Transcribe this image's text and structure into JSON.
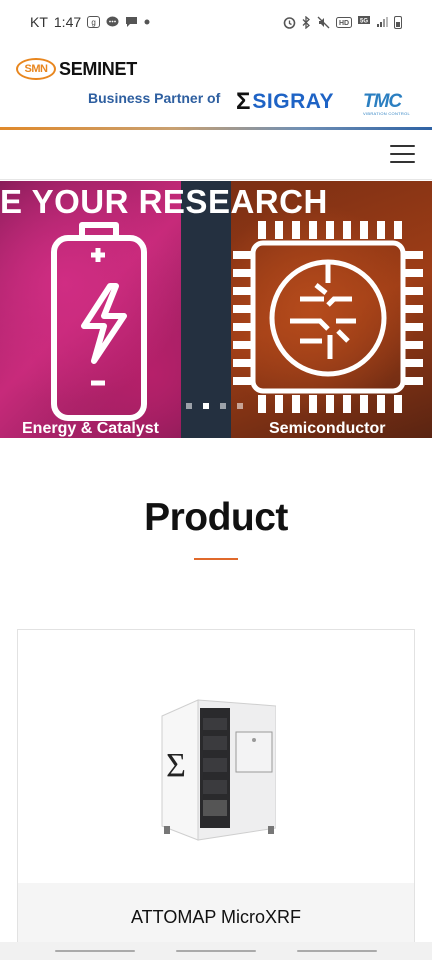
{
  "status_bar": {
    "carrier": "KT",
    "time": "1:47",
    "left_icons": [
      "g-icon",
      "chat-bubble-icon",
      "message-icon",
      "dot-icon"
    ],
    "right_icons": [
      "alarm-icon",
      "bluetooth-icon",
      "mute-icon",
      "hd-icon",
      "5g-icon",
      "signal-icon",
      "battery-icon"
    ]
  },
  "header": {
    "logo_badge": "SMN",
    "logo_text": "SEMINET",
    "partner_label": "Business Partner of",
    "partner_1": "SIGRAY",
    "partner_1_mark": "Σ",
    "partner_2": "TMC",
    "partner_2_sub": "VIBRATION CONTROL"
  },
  "nav": {
    "menu_icon": "hamburger-menu-icon"
  },
  "banner": {
    "headline": "E YOUR RESEARCH",
    "slides": [
      {
        "caption": "Energy & Catalyst",
        "icon": "battery-lightning-icon"
      },
      {
        "caption": "Semiconductor",
        "icon": "circuit-chip-icon"
      }
    ],
    "dots_count": 4,
    "active_dot": 2
  },
  "products": {
    "section_title": "Product",
    "accent_color": "#e0692b",
    "items": [
      {
        "name": "ATTOMAP MicroXRF",
        "image": "xrf-instrument-cabinet"
      }
    ]
  },
  "colors": {
    "brand_orange": "#e8861e",
    "brand_blue": "#2e5fa0",
    "sigray_blue": "#1e63c5"
  }
}
